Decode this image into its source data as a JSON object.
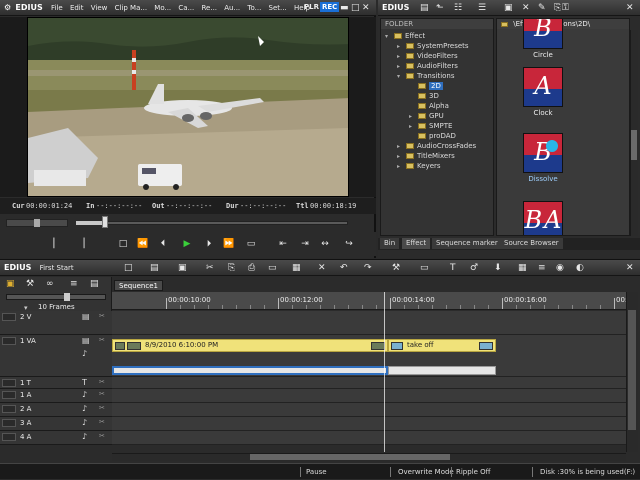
{
  "player": {
    "logo": "EDIUS",
    "menu": [
      "File",
      "Edit",
      "View",
      "Clip Ma...",
      "Mo...",
      "Ca...",
      "Re...",
      "Au...",
      "To...",
      "Set...",
      "Help"
    ],
    "plr": "PLR",
    "rec": "REC",
    "tc": {
      "cur_label": "Cur",
      "cur": "00:00:01:24",
      "in_label": "In",
      "in": "--:--:--:--",
      "out_label": "Out",
      "out": "--:--:--:--",
      "dur_label": "Dur",
      "dur": "--:--:--:--",
      "ttl_label": "Ttl",
      "ttl": "00:00:18:19"
    }
  },
  "bin": {
    "logo": "EDIUS",
    "folder_header": "FOLDER",
    "path": "\\Effect\\Transitions\\2D\\",
    "tree": [
      {
        "label": "Effect",
        "level": 0,
        "exp": "▾"
      },
      {
        "label": "SystemPresets",
        "level": 1,
        "exp": "▸"
      },
      {
        "label": "VideoFilters",
        "level": 1,
        "exp": "▸"
      },
      {
        "label": "AudioFilters",
        "level": 1,
        "exp": "▸"
      },
      {
        "label": "Transitions",
        "level": 1,
        "exp": "▾"
      },
      {
        "label": "2D",
        "level": 2,
        "exp": "",
        "sel": true
      },
      {
        "label": "3D",
        "level": 2,
        "exp": ""
      },
      {
        "label": "Alpha",
        "level": 2,
        "exp": ""
      },
      {
        "label": "GPU",
        "level": 2,
        "exp": "▸"
      },
      {
        "label": "SMPTE",
        "level": 2,
        "exp": "▸"
      },
      {
        "label": "proDAD",
        "level": 2,
        "exp": ""
      },
      {
        "label": "AudioCrossFades",
        "level": 1,
        "exp": "▸"
      },
      {
        "label": "TitleMixers",
        "level": 1,
        "exp": "▸"
      },
      {
        "label": "Keyers",
        "level": 1,
        "exp": "▸"
      }
    ],
    "effects": [
      {
        "name": "Circle",
        "letters": "B"
      },
      {
        "name": "Clock",
        "letters": "A"
      },
      {
        "name": "Dissolve",
        "letters": "B"
      },
      {
        "name": "",
        "letters": "BA"
      }
    ],
    "tabs": [
      "Bin",
      "Effect",
      "Sequence marker",
      "Source Browser"
    ]
  },
  "timeline": {
    "logo": "EDIUS",
    "project": "First Start",
    "zoom": "10 Frames",
    "sequence_tab": "Sequence1",
    "ruler": [
      "00:00:10:00",
      "00:00:12:00",
      "00:00:14:00",
      "00:00:16:00",
      "00:00:18:00",
      "00:00:20:00"
    ],
    "tracks": [
      "2 V",
      "1 VA",
      "1 T",
      "1 A",
      "2 A",
      "3 A",
      "4 A"
    ],
    "clip1": "8/9/2010 6:10:00 PM",
    "clip2": "take off"
  },
  "status": {
    "pause": "Pause",
    "mode": "Overwrite Mode",
    "ripple": "Ripple Off",
    "disk": "Disk :30% is being used(F:)"
  },
  "colors": {
    "rec": "#1a6fd6",
    "clip": "#f0e27a",
    "sel": "#2f6fbf",
    "accent_green": "#3ad03a"
  }
}
